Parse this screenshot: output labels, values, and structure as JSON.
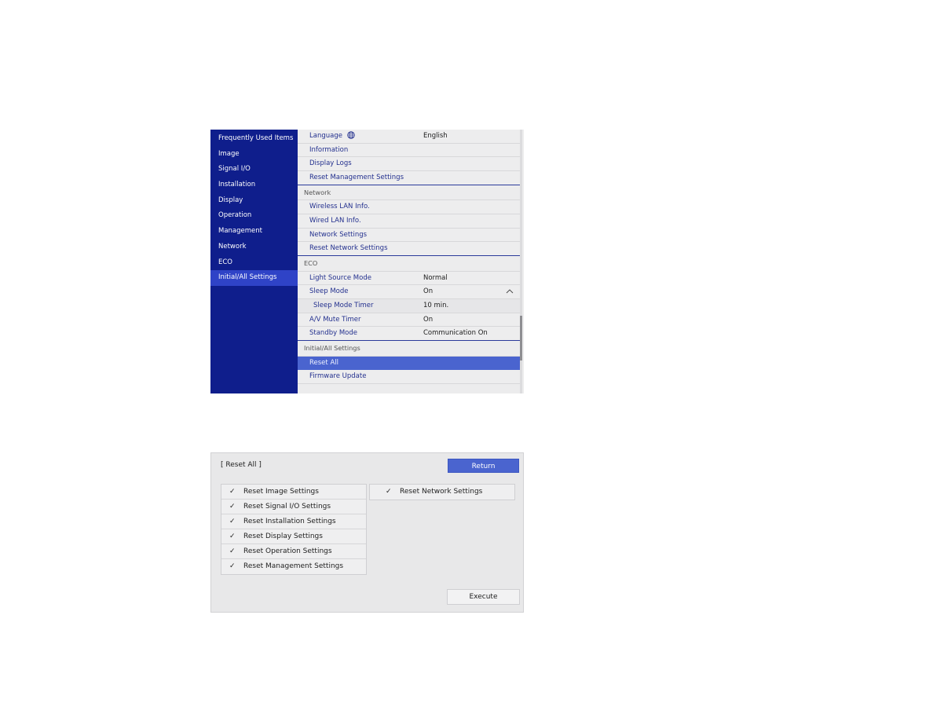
{
  "menu": {
    "sidebar": {
      "items": [
        {
          "label": "Frequently Used Items"
        },
        {
          "label": "Image"
        },
        {
          "label": "Signal I/O"
        },
        {
          "label": "Installation"
        },
        {
          "label": "Display"
        },
        {
          "label": "Operation"
        },
        {
          "label": "Management"
        },
        {
          "label": "Network"
        },
        {
          "label": "ECO"
        },
        {
          "label": "Initial/All Settings",
          "active": true
        }
      ]
    },
    "management_rows": [
      {
        "label": "Language",
        "value": "English",
        "icon": "globe-icon"
      },
      {
        "label": "Information"
      },
      {
        "label": "Display Logs"
      },
      {
        "label": "Reset Management Settings"
      }
    ],
    "network": {
      "header": "Network",
      "rows": [
        {
          "label": "Wireless LAN Info."
        },
        {
          "label": "Wired LAN Info."
        },
        {
          "label": "Network Settings"
        },
        {
          "label": "Reset Network Settings"
        }
      ]
    },
    "eco": {
      "header": "ECO",
      "rows": [
        {
          "label": "Light Source Mode",
          "value": "Normal"
        },
        {
          "label": "Sleep Mode",
          "value": "On",
          "icon": "chevron-up-icon"
        },
        {
          "label": "Sleep Mode Timer",
          "value": "10 min."
        },
        {
          "label": "A/V Mute Timer",
          "value": "On"
        },
        {
          "label": "Standby Mode",
          "value": "Communication On"
        }
      ]
    },
    "initial": {
      "header": "Initial/All Settings",
      "rows": [
        {
          "label": "Reset All",
          "selected": true
        },
        {
          "label": "Firmware Update"
        }
      ]
    },
    "scroll_position": 0.85
  },
  "dialog": {
    "title": "[ Reset All ]",
    "return_label": "Return",
    "execute_label": "Execute",
    "check_mark": "✓",
    "left_items": [
      {
        "label": "Reset Image Settings",
        "checked": true
      },
      {
        "label": "Reset Signal I/O Settings",
        "checked": true
      },
      {
        "label": "Reset Installation Settings",
        "checked": true
      },
      {
        "label": "Reset Display Settings",
        "checked": true
      },
      {
        "label": "Reset Operation Settings",
        "checked": true
      },
      {
        "label": "Reset Management Settings",
        "checked": true
      }
    ],
    "right_items": [
      {
        "label": "Reset Network Settings",
        "checked": true
      }
    ]
  }
}
